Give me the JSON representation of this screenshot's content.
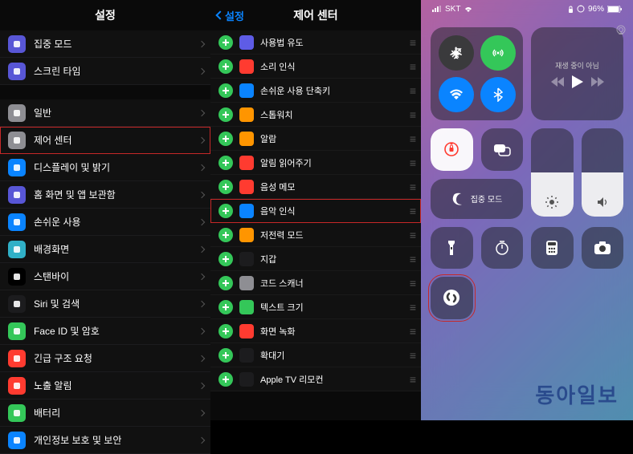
{
  "watermark": "동아일보",
  "left": {
    "title": "설정",
    "items": [
      {
        "label": "집중 모드",
        "icon_bg": "#5856d6",
        "glyph": "moon"
      },
      {
        "label": "스크린 타임",
        "icon_bg": "#5856d6",
        "glyph": "hourglass"
      },
      {
        "gap": true
      },
      {
        "label": "일반",
        "icon_bg": "#8e8e93",
        "glyph": "gear"
      },
      {
        "label": "제어 센터",
        "icon_bg": "#8e8e93",
        "glyph": "switches",
        "highlight": true
      },
      {
        "label": "디스플레이 및 밝기",
        "icon_bg": "#0a84ff",
        "glyph": "display"
      },
      {
        "label": "홈 화면 및 앱 보관함",
        "icon_bg": "#5856d6",
        "glyph": "grid"
      },
      {
        "label": "손쉬운 사용",
        "icon_bg": "#0a84ff",
        "glyph": "person"
      },
      {
        "label": "배경화면",
        "icon_bg": "#30b0c7",
        "glyph": "flower"
      },
      {
        "label": "스탠바이",
        "icon_bg": "#000",
        "glyph": "clock"
      },
      {
        "label": "Siri 및 검색",
        "icon_bg": "#1c1c1e",
        "glyph": "siri"
      },
      {
        "label": "Face ID 및 암호",
        "icon_bg": "#34c759",
        "glyph": "faceid"
      },
      {
        "label": "긴급 구조 요청",
        "icon_bg": "#ff3b30",
        "glyph": "sos"
      },
      {
        "label": "노출 알림",
        "icon_bg": "#ff3b30",
        "glyph": "virus"
      },
      {
        "label": "배터리",
        "icon_bg": "#34c759",
        "glyph": "battery"
      },
      {
        "label": "개인정보 보호 및 보안",
        "icon_bg": "#0a84ff",
        "glyph": "hand"
      }
    ]
  },
  "mid": {
    "back_label": "설정",
    "title": "제어 센터",
    "items": [
      {
        "label": "사용법 유도",
        "icon_bg": "#5e5ce6"
      },
      {
        "label": "소리 인식",
        "icon_bg": "#ff3b30"
      },
      {
        "label": "손쉬운 사용 단축키",
        "icon_bg": "#0a84ff"
      },
      {
        "label": "스톱워치",
        "icon_bg": "#ff9500"
      },
      {
        "label": "알람",
        "icon_bg": "#ff9500"
      },
      {
        "label": "알림 읽어주기",
        "icon_bg": "#ff3b30"
      },
      {
        "label": "음성 메모",
        "icon_bg": "#ff3b30"
      },
      {
        "label": "음악 인식",
        "icon_bg": "#0a84ff",
        "highlight": true
      },
      {
        "label": "저전력 모드",
        "icon_bg": "#ff9500"
      },
      {
        "label": "지갑",
        "icon_bg": "#1c1c1e"
      },
      {
        "label": "코드 스캐너",
        "icon_bg": "#8e8e93"
      },
      {
        "label": "텍스트 크기",
        "icon_bg": "#34c759"
      },
      {
        "label": "화면 녹화",
        "icon_bg": "#ff3b30"
      },
      {
        "label": "확대기",
        "icon_bg": "#1c1c1e"
      },
      {
        "label": "Apple TV 리모컨",
        "icon_bg": "#1c1c1e"
      }
    ]
  },
  "right": {
    "status": {
      "carrier": "SKT",
      "battery": "96%"
    },
    "music": {
      "status_text": "재생 중이 아님"
    },
    "focus_label": "집중 모드",
    "brightness_fill": 0.5,
    "volume_fill": 0.5
  }
}
